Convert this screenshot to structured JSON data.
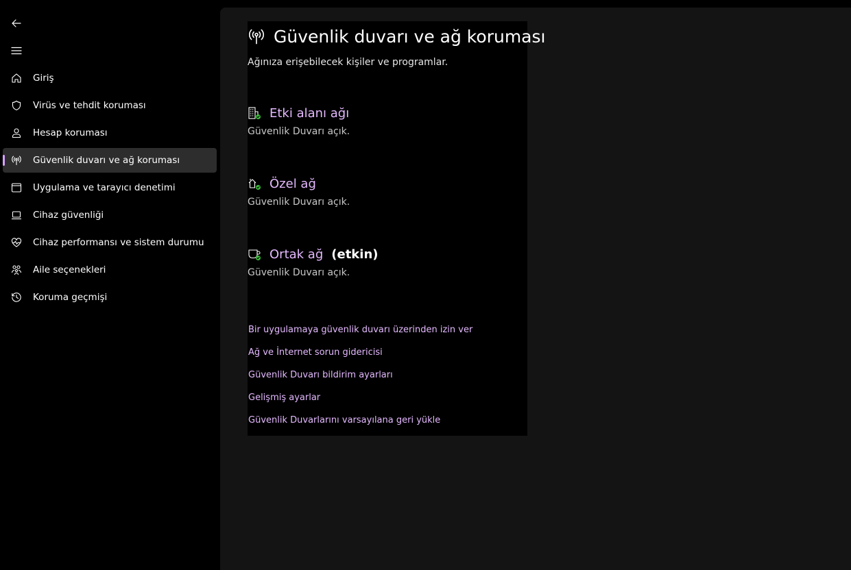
{
  "sidebar": {
    "items": [
      {
        "label": "Giriş",
        "icon": "home-icon"
      },
      {
        "label": "Virüs ve tehdit koruması",
        "icon": "shield-icon"
      },
      {
        "label": "Hesap koruması",
        "icon": "person-icon"
      },
      {
        "label": "Güvenlik duvarı ve ağ koruması",
        "icon": "antenna-icon",
        "active": true
      },
      {
        "label": "Uygulama ve tarayıcı denetimi",
        "icon": "browser-window-icon"
      },
      {
        "label": "Cihaz güvenliği",
        "icon": "laptop-icon"
      },
      {
        "label": "Cihaz performansı ve sistem durumu",
        "icon": "heart-pulse-icon"
      },
      {
        "label": "Aile seçenekleri",
        "icon": "family-icon"
      },
      {
        "label": "Koruma geçmişi",
        "icon": "history-icon"
      }
    ]
  },
  "main": {
    "title": "Güvenlik duvarı ve ağ koruması",
    "subtitle": "Ağınıza erişebilecek kişiler ve programlar.",
    "networks": [
      {
        "name": "Etki alanı ağı",
        "status": "Güvenlik Duvarı açık.",
        "active_label": "",
        "icon": "domain-network-icon"
      },
      {
        "name": "Özel ağ",
        "status": "Güvenlik Duvarı açık.",
        "active_label": "",
        "icon": "private-network-icon"
      },
      {
        "name": "Ortak ağ",
        "status": "Güvenlik Duvarı açık.",
        "active_label": "(etkin)",
        "icon": "public-network-icon"
      }
    ],
    "links": [
      "Bir uygulamaya güvenlik duvarı üzerinden izin ver",
      "Ağ ve İnternet sorun gidericisi",
      "Güvenlik Duvarı bildirim ayarları",
      "Gelişmiş ayarlar",
      "Güvenlik Duvarlarını varsayılana geri yükle"
    ]
  },
  "colors": {
    "accent": "#e4b9ff",
    "status_ok": "#3cc13c",
    "sidebar_active_bg": "#2d2d2d",
    "main_bg": "#141414"
  }
}
